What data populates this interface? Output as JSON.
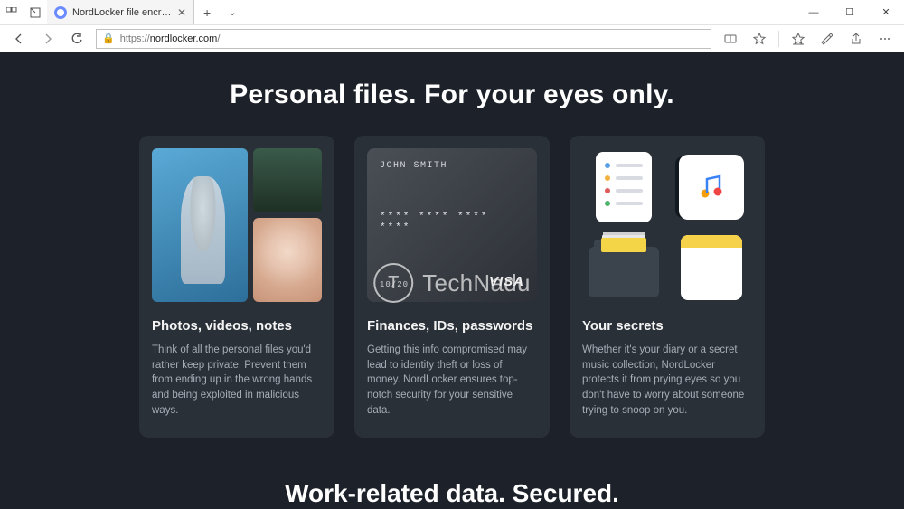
{
  "window": {
    "tab_title": "NordLocker file encrypt",
    "win_minimize": "—",
    "win_maximize": "☐",
    "win_close": "✕"
  },
  "addressbar": {
    "url_prefix": "https://",
    "url_host": "nordlocker.com",
    "url_path": "/"
  },
  "page": {
    "headline": "Personal files. For your eyes only.",
    "subhead": "Work-related data. Secured.",
    "cards": [
      {
        "title": "Photos, videos, notes",
        "desc": "Think of all the personal files you'd rather keep private. Prevent them from ending up in the wrong hands and being exploited in malicious ways."
      },
      {
        "title": "Finances, IDs, passwords",
        "desc": "Getting this info compromised may lead to identity theft or loss of money. NordLocker ensures top-notch security for your sensitive data."
      },
      {
        "title": "Your secrets",
        "desc": "Whether it's your diary or a secret music collection, NordLocker protects it from prying eyes so you don't have to worry about someone trying to snoop on you."
      }
    ],
    "creditcard": {
      "name": "JOHN SMITH",
      "number": "**** **** **** ****",
      "expiry": "10/20",
      "brand": "VISA"
    }
  },
  "watermark": {
    "glyph": "T",
    "text": "TechNadu"
  }
}
